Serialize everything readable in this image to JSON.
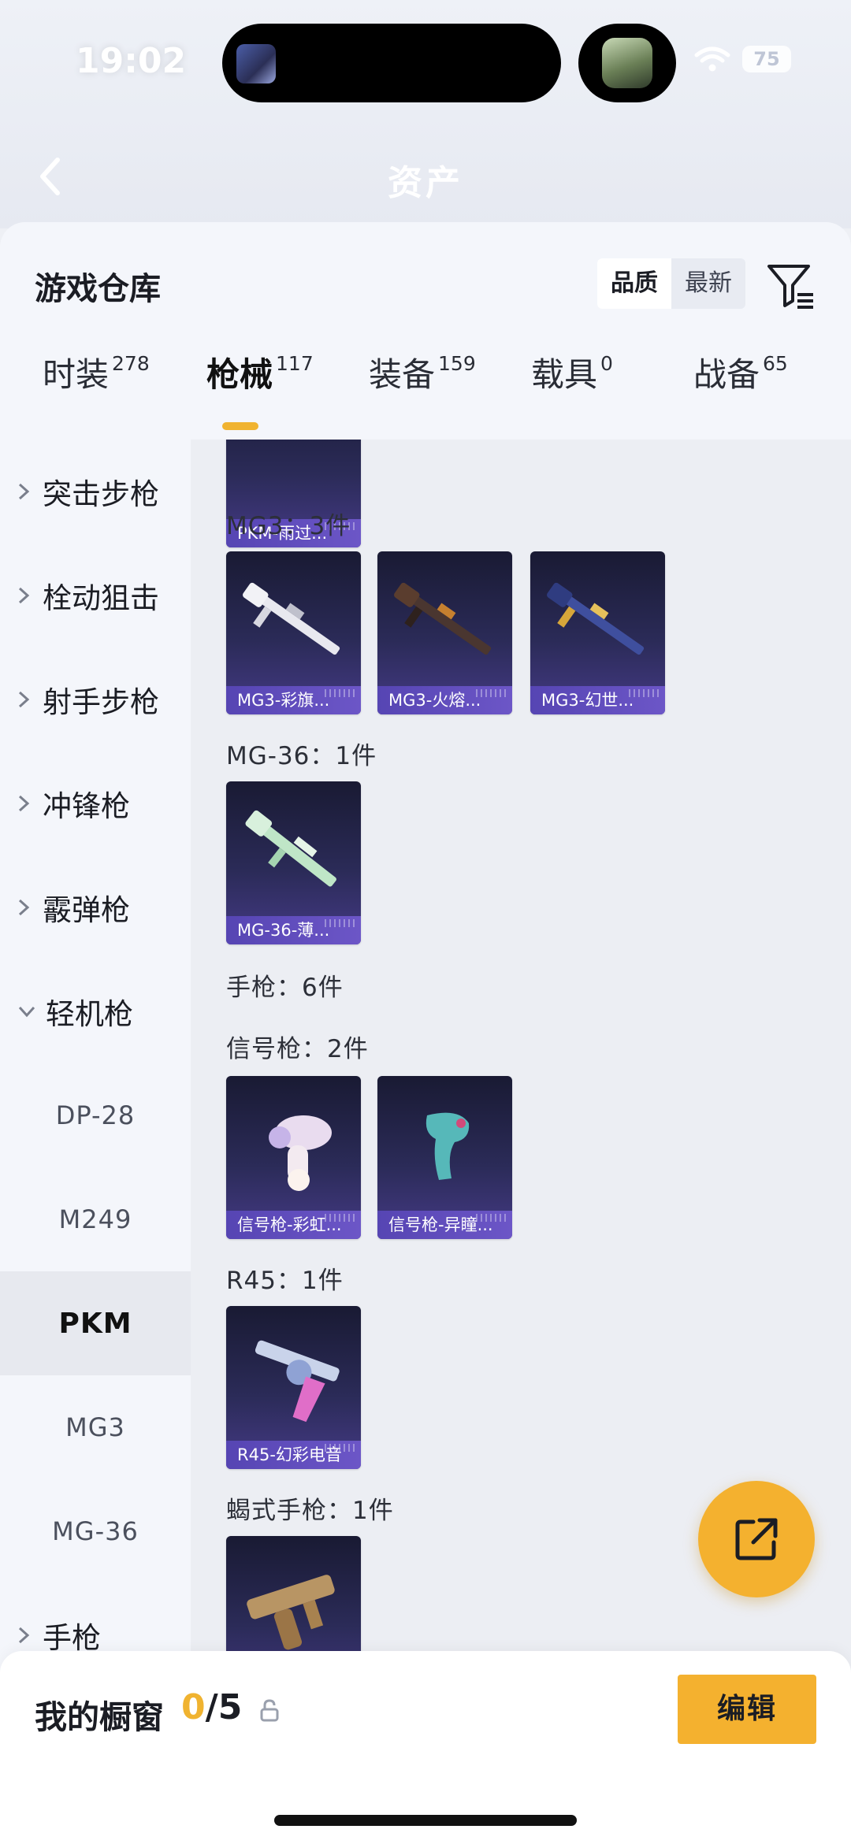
{
  "status": {
    "time": "19:02",
    "battery": "75"
  },
  "header": {
    "title": "资产"
  },
  "sheet": {
    "title": "游戏仓库"
  },
  "sort": {
    "quality": "品质",
    "latest": "最新"
  },
  "tabs": [
    {
      "label": "时装",
      "count": "278"
    },
    {
      "label": "枪械",
      "count": "117"
    },
    {
      "label": "装备",
      "count": "159"
    },
    {
      "label": "载具",
      "count": "0"
    },
    {
      "label": "战备",
      "count": "65"
    }
  ],
  "sidebar": {
    "categories": [
      "突击步枪",
      "栓动狙击",
      "射手步枪",
      "冲锋枪",
      "霰弹枪",
      "轻机枪"
    ],
    "sub": [
      "DP-28",
      "M249",
      "PKM",
      "MG3",
      "MG-36"
    ],
    "pistol": "手枪"
  },
  "groups": {
    "pkm_card": "PKM-雨过...",
    "mg3_title": "MG3：3件",
    "mg3_cards": [
      "MG3-彩旗...",
      "MG3-火熔...",
      "MG3-幻世..."
    ],
    "mg36_title": "MG-36：1件",
    "mg36_cards": [
      "MG-36-薄..."
    ],
    "pistol_title": "手枪：6件",
    "flare_title": "信号枪：2件",
    "flare_cards": [
      "信号枪-彩虹...",
      "信号枪-异瞳..."
    ],
    "r45_title": "R45：1件",
    "r45_cards": [
      "R45-幻彩电音"
    ],
    "scorpion_title": "蝎式手枪：1件"
  },
  "showcase": {
    "title": "我的橱窗",
    "current": "0",
    "total": "/5",
    "edit": "编辑"
  },
  "colors": {
    "accent": "#f4b12f",
    "card_caption": "#5f4bc0"
  }
}
